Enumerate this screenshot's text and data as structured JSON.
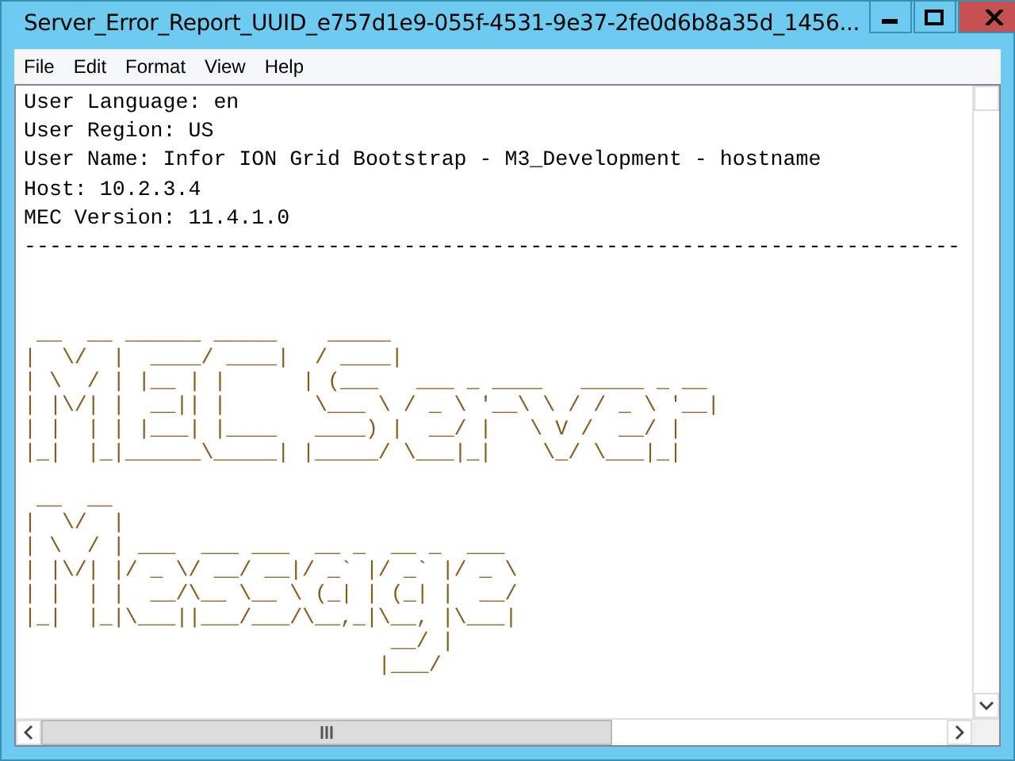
{
  "window": {
    "title": "Server_Error_Report_UUID_e757d1e9-055f-4531-9e37-2fe0d6b8a35d_1456..."
  },
  "menu": [
    "File",
    "Edit",
    "Format",
    "View",
    "Help"
  ],
  "header_lines": [
    "User Language: en",
    "User Region: US",
    "User Name: Infor ION Grid Bootstrap - M3_Development - hostname",
    "Host: 10.2.3.4",
    "MEC Version: 11.4.1.0"
  ],
  "separator": "--------------------------------------------------------------------------",
  "banners": [
    [
      " __  __ ______ _____    _____                          ",
      "|  \\/  |  ____/ ____|  / ____|                         ",
      "| \\  / | |__ | |      | (___   ___ _ ____   _____ _ __ ",
      "| |\\/| |  __|| |       \\___ \\ / _ \\ '__\\ \\ / / _ \\ '__|",
      "| |  | | |___| |____   ____) |  __/ |   \\ V /  __/ |   ",
      "|_|  |_|______\\_____| |_____/ \\___|_|    \\_/ \\___|_|   "
    ],
    [
      " __  __                                ",
      "|  \\/  |                               ",
      "| \\  / | ___  ___ ___  __ _  __ _  ___ ",
      "| |\\/| |/ _ \\/ __/ __|/ _` |/ _` |/ _ \\",
      "| |  | |  __/\\__ \\__ \\ (_| | (_| |  __/",
      "|_|  |_|\\___||___/___/\\__,_|\\__, |\\___|",
      "                             __/ |     ",
      "                            |___/      "
    ]
  ]
}
